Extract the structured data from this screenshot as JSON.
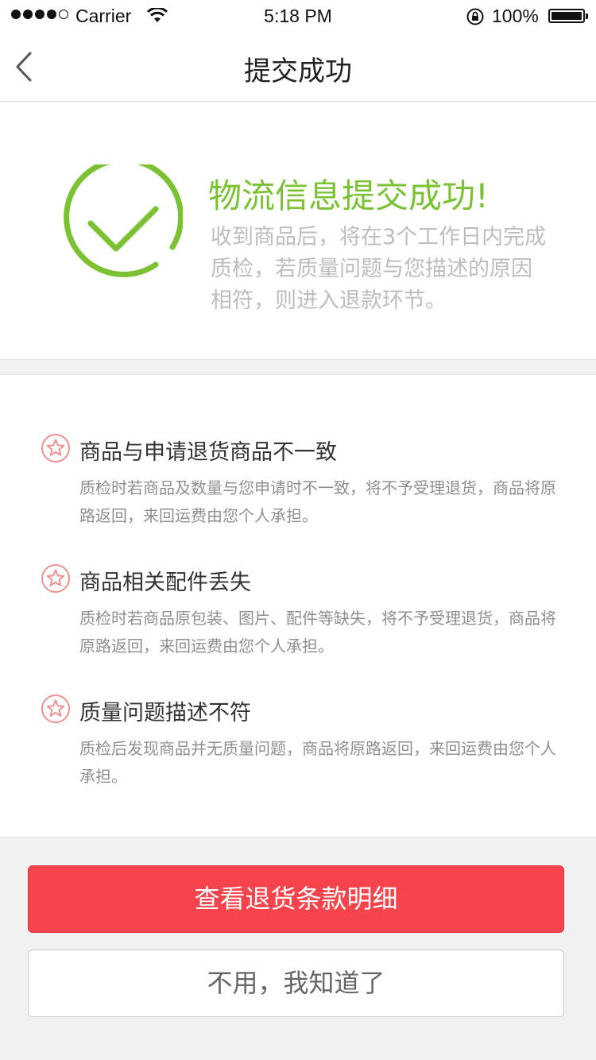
{
  "status_bar": {
    "carrier": "Carrier",
    "time": "5:18 PM",
    "battery": "100%"
  },
  "nav": {
    "title": "提交成功",
    "back_icon": "chevron-left-icon"
  },
  "success": {
    "title": "物流信息提交成功!",
    "description": "收到商品后，将在3个工作日内完成质检，若质量问题与您描述的原因相符，则进入退款环节。",
    "accent_color": "#7ac231"
  },
  "rules": [
    {
      "title": "商品与申请退货商品不一致",
      "description": "质检时若商品及数量与您申请时不一致，将不予受理退货，商品将原路返回，来回运费由您个人承担。"
    },
    {
      "title": "商品相关配件丢失",
      "description": "质检时若商品原包装、图片、配件等缺失，将不予受理退货，商品将原路返回，来回运费由您个人承担。"
    },
    {
      "title": "质量问题描述不符",
      "description": "质检后发现商品并无质量问题，商品将原路返回，来回运费由您个人承担。"
    }
  ],
  "actions": {
    "primary_label": "查看退货条款明细",
    "secondary_label": "不用，我知道了",
    "primary_color": "#f7434b"
  }
}
